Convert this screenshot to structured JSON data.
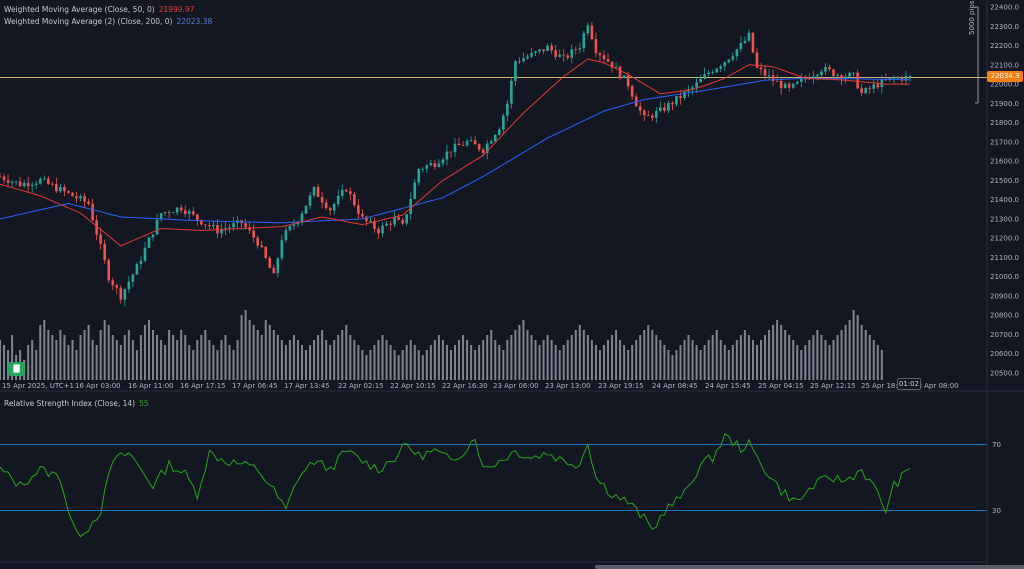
{
  "indicators": {
    "wma50": {
      "label": "Weighted Moving Average (Close, 50, 0)",
      "value": "21999.97",
      "color": "#e53935"
    },
    "wma200": {
      "label": "Weighted Moving Average (2) (Close, 200, 0)",
      "value": "22023.38",
      "color": "#2962ff"
    },
    "rsi": {
      "label": "Relative Strength Index (Close, 14)",
      "value": "55",
      "color": "#26a41a"
    }
  },
  "price_tag": "22034.3",
  "time_tag": "01:02",
  "pips_label": "5000 pips",
  "logo_glyph": "🀫",
  "colors": {
    "up": "#26a69a",
    "down": "#ef5350",
    "rsi_band": "#2196f3",
    "hline": "#c9b26b",
    "volume": "#9598a1",
    "tag": "#f57f17"
  },
  "chart_data": {
    "type": "candlestick",
    "y_ticks": [
      "22400.0",
      "22300.0",
      "22200.0",
      "22100.0",
      "22000.0",
      "21900.0",
      "21800.0",
      "21700.0",
      "21600.0",
      "21500.0",
      "21400.0",
      "21300.0",
      "21200.0",
      "21100.0",
      "21000.0",
      "20900.0",
      "20800.0",
      "20700.0",
      "20600.0",
      "20500.0"
    ],
    "y_range": [
      20500,
      22400
    ],
    "x_ticks": [
      "15 Apr 2025, UTC+1",
      "16 Apr 03:00",
      "16 Apr 11:00",
      "16 Apr 17:15",
      "17 Apr 06:45",
      "17 Apr 13:45",
      "22 Apr 02:15",
      "22 Apr 10:15",
      "22 Apr 16:30",
      "23 Apr 06:00",
      "23 Apr 13:00",
      "23 Apr 19:15",
      "24 Apr 08:45",
      "24 Apr 15:45",
      "25 Apr 04:15",
      "25 Apr 12:15",
      "25 Apr 18:30",
      "28 Apr 08:00"
    ],
    "horizontal_line": 22034.3,
    "close_path": [
      [
        0,
        21520
      ],
      [
        5,
        21480
      ],
      [
        10,
        21500
      ],
      [
        15,
        21450
      ],
      [
        22,
        21380
      ],
      [
        27,
        21000
      ],
      [
        30,
        20900
      ],
      [
        34,
        21050
      ],
      [
        40,
        21330
      ],
      [
        45,
        21360
      ],
      [
        49,
        21300
      ],
      [
        54,
        21240
      ],
      [
        60,
        21280
      ],
      [
        64,
        21180
      ],
      [
        68,
        21000
      ],
      [
        70,
        21200
      ],
      [
        74,
        21300
      ],
      [
        78,
        21450
      ],
      [
        82,
        21350
      ],
      [
        86,
        21460
      ],
      [
        90,
        21300
      ],
      [
        94,
        21240
      ],
      [
        98,
        21300
      ],
      [
        100,
        21260
      ],
      [
        104,
        21560
      ],
      [
        108,
        21590
      ],
      [
        112,
        21660
      ],
      [
        116,
        21700
      ],
      [
        120,
        21660
      ],
      [
        124,
        21780
      ],
      [
        126,
        21900
      ],
      [
        128,
        22120
      ],
      [
        132,
        22150
      ],
      [
        136,
        22190
      ],
      [
        140,
        22130
      ],
      [
        144,
        22200
      ],
      [
        146,
        22320
      ],
      [
        148,
        22180
      ],
      [
        152,
        22100
      ],
      [
        156,
        22000
      ],
      [
        158,
        21900
      ],
      [
        160,
        21820
      ],
      [
        164,
        21860
      ],
      [
        168,
        21920
      ],
      [
        172,
        21980
      ],
      [
        176,
        22060
      ],
      [
        180,
        22120
      ],
      [
        184,
        22200
      ],
      [
        186,
        22250
      ],
      [
        188,
        22080
      ],
      [
        192,
        22020
      ],
      [
        196,
        21970
      ],
      [
        200,
        22030
      ],
      [
        204,
        22080
      ],
      [
        208,
        22050
      ],
      [
        212,
        22040
      ],
      [
        214,
        21950
      ],
      [
        218,
        22000
      ],
      [
        222,
        22030
      ],
      [
        226,
        22034
      ]
    ],
    "wma50_path": [
      [
        0,
        21480
      ],
      [
        10,
        21420
      ],
      [
        20,
        21330
      ],
      [
        30,
        21160
      ],
      [
        40,
        21250
      ],
      [
        50,
        21240
      ],
      [
        60,
        21250
      ],
      [
        70,
        21260
      ],
      [
        80,
        21310
      ],
      [
        90,
        21270
      ],
      [
        100,
        21320
      ],
      [
        110,
        21500
      ],
      [
        120,
        21630
      ],
      [
        130,
        21850
      ],
      [
        140,
        22040
      ],
      [
        146,
        22130
      ],
      [
        150,
        22110
      ],
      [
        156,
        22050
      ],
      [
        164,
        21950
      ],
      [
        172,
        21970
      ],
      [
        180,
        22030
      ],
      [
        186,
        22100
      ],
      [
        192,
        22090
      ],
      [
        200,
        22030
      ],
      [
        210,
        22020
      ],
      [
        220,
        22000
      ],
      [
        226,
        22000
      ]
    ],
    "wma200_path": [
      [
        0,
        21300
      ],
      [
        17,
        21380
      ],
      [
        30,
        21310
      ],
      [
        50,
        21290
      ],
      [
        70,
        21280
      ],
      [
        90,
        21300
      ],
      [
        110,
        21410
      ],
      [
        120,
        21520
      ],
      [
        136,
        21720
      ],
      [
        150,
        21860
      ],
      [
        160,
        21920
      ],
      [
        176,
        21970
      ],
      [
        190,
        22020
      ],
      [
        200,
        22030
      ],
      [
        226,
        22023
      ]
    ],
    "rsi": {
      "levels": [
        70,
        30
      ],
      "labels": [
        "70",
        "30"
      ],
      "path": [
        [
          0,
          55
        ],
        [
          5,
          45
        ],
        [
          10,
          55
        ],
        [
          15,
          50
        ],
        [
          17,
          30
        ],
        [
          19,
          15
        ],
        [
          22,
          20
        ],
        [
          25,
          30
        ],
        [
          28,
          60
        ],
        [
          32,
          65
        ],
        [
          35,
          55
        ],
        [
          38,
          45
        ],
        [
          42,
          58
        ],
        [
          46,
          52
        ],
        [
          49,
          40
        ],
        [
          52,
          65
        ],
        [
          56,
          60
        ],
        [
          60,
          58
        ],
        [
          64,
          55
        ],
        [
          68,
          42
        ],
        [
          71,
          30
        ],
        [
          74,
          50
        ],
        [
          78,
          60
        ],
        [
          82,
          55
        ],
        [
          86,
          66
        ],
        [
          90,
          60
        ],
        [
          94,
          55
        ],
        [
          98,
          62
        ],
        [
          101,
          70
        ],
        [
          104,
          63
        ],
        [
          108,
          66
        ],
        [
          112,
          60
        ],
        [
          116,
          68
        ],
        [
          118,
          75
        ],
        [
          120,
          55
        ],
        [
          124,
          60
        ],
        [
          128,
          66
        ],
        [
          132,
          62
        ],
        [
          136,
          65
        ],
        [
          140,
          60
        ],
        [
          144,
          58
        ],
        [
          146,
          72
        ],
        [
          148,
          50
        ],
        [
          152,
          40
        ],
        [
          156,
          35
        ],
        [
          160,
          25
        ],
        [
          162,
          18
        ],
        [
          165,
          30
        ],
        [
          170,
          40
        ],
        [
          174,
          58
        ],
        [
          177,
          62
        ],
        [
          180,
          75
        ],
        [
          184,
          68
        ],
        [
          186,
          70
        ],
        [
          188,
          62
        ],
        [
          190,
          55
        ],
        [
          194,
          42
        ],
        [
          198,
          35
        ],
        [
          202,
          45
        ],
        [
          206,
          50
        ],
        [
          210,
          48
        ],
        [
          214,
          55
        ],
        [
          218,
          40
        ],
        [
          220,
          30
        ],
        [
          222,
          45
        ],
        [
          226,
          55
        ]
      ]
    },
    "volume": {
      "values": [
        40,
        35,
        30,
        45,
        25,
        30,
        20,
        35,
        40,
        30,
        55,
        60,
        50,
        45,
        40,
        50,
        45,
        35,
        40,
        30,
        45,
        50,
        55,
        40,
        35,
        50,
        60,
        55,
        45,
        40,
        35,
        45,
        50,
        40,
        30,
        45,
        55,
        60,
        50,
        45,
        40,
        35,
        50,
        45,
        40,
        50,
        45,
        35,
        30,
        40,
        45,
        50,
        40,
        35,
        30,
        40,
        45,
        35,
        30,
        40,
        65,
        70,
        60,
        55,
        50,
        45,
        60,
        55,
        50,
        45,
        40,
        35,
        40,
        45,
        40,
        35,
        30,
        35,
        40,
        45,
        50,
        40,
        35,
        40,
        45,
        50,
        55,
        45,
        40,
        35,
        30,
        25,
        30,
        35,
        40,
        45,
        40,
        35,
        30,
        25,
        30,
        35,
        40,
        35,
        30,
        25,
        30,
        35,
        40,
        45,
        40,
        35,
        30,
        35,
        40,
        45,
        40,
        35,
        30,
        35,
        40,
        45,
        50,
        40,
        35,
        30,
        40,
        45,
        50,
        55,
        60,
        50,
        45,
        40,
        35,
        40,
        45,
        40,
        35,
        30,
        35,
        40,
        45,
        50,
        55,
        50,
        45,
        40,
        35,
        30,
        35,
        40,
        45,
        50,
        40,
        35,
        30,
        35,
        40,
        45,
        50,
        55,
        50,
        45,
        40,
        35,
        30,
        25,
        30,
        35,
        40,
        45,
        40,
        35,
        30,
        35,
        40,
        45,
        50,
        40,
        35,
        30,
        35,
        40,
        45,
        50,
        45,
        40,
        35,
        40,
        45,
        50,
        55,
        60,
        55,
        50,
        45,
        40,
        35,
        30,
        35,
        40,
        45,
        50,
        45,
        40,
        35,
        40,
        45,
        50,
        55,
        60,
        70,
        65,
        55,
        50,
        45,
        40,
        35,
        30
      ]
    }
  }
}
